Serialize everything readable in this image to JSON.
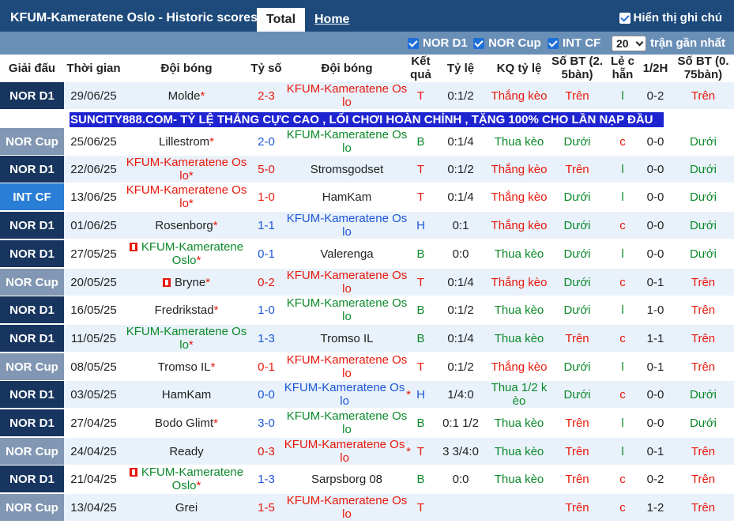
{
  "header": {
    "title": "KFUM-Kameratene Oslo - Historic scores",
    "tab_total": "Total",
    "tab_home": "Home",
    "show_label": "Hiển thị ghi chú"
  },
  "filters": {
    "nor_d1": "NOR D1",
    "nor_cup": "NOR Cup",
    "int_cf": "INT CF",
    "count": "20",
    "count_suffix": "trận gần nhất"
  },
  "columns": {
    "league": "Giải đấu",
    "time": "Thời gian",
    "home": "Đội bóng",
    "score": "Tỷ số",
    "away": "Đội bóng",
    "result": "Kết quả",
    "rate": "Tỷ lệ",
    "kq_rate": "KQ tỷ lệ",
    "bt25": "Số BT (2. 5bàn)",
    "odd_even": "Lẻ c hẵn",
    "half": "1/2H",
    "bt075": "Số BT (0. 75bàn)"
  },
  "ad_text": "SUNCITY888.COM- TỶ LỆ THẮNG CỰC CAO , LỐI CHƠI HOÀN CHỈNH , TẶNG 100% CHO LẦN NẠP ĐẦU",
  "rows": [
    {
      "league": "NOR D1",
      "date": "29/06/25",
      "home": "Molde",
      "home_star": "*",
      "score": "2-3",
      "away": "KFUM-Kameratene Os lo",
      "away_star": "",
      "result": "T",
      "rate": "0:1/2",
      "kq": "Thắng kèo",
      "bt": "Trên",
      "le": "l",
      "half": "0-2",
      "bt2": "Trên"
    },
    {
      "league": "NOR Cup",
      "date": "25/06/25",
      "home": "Lillestrom",
      "home_star": "*",
      "score": "2-0",
      "away": "KFUM-Kameratene Os lo",
      "away_star": "",
      "result": "B",
      "rate": "0:1/4",
      "kq": "Thua kèo",
      "bt": "Dưới",
      "le": "c",
      "half": "0-0",
      "bt2": "Dưới"
    },
    {
      "league": "NOR D1",
      "date": "22/06/25",
      "home": "KFUM-Kameratene Os lo",
      "home_star": "*",
      "score": "5-0",
      "away": "Stromsgodset",
      "away_star": "",
      "result": "T",
      "rate": "0:1/2",
      "kq": "Thắng kèo",
      "bt": "Trên",
      "le": "l",
      "half": "0-0",
      "bt2": "Dưới"
    },
    {
      "league": "INT CF",
      "date": "13/06/25",
      "home": "KFUM-Kameratene Os lo",
      "home_star": "*",
      "score": "1-0",
      "away": "HamKam",
      "away_star": "",
      "result": "T",
      "rate": "0:1/4",
      "kq": "Thắng kèo",
      "bt": "Dưới",
      "le": "l",
      "half": "0-0",
      "bt2": "Dưới"
    },
    {
      "league": "NOR D1",
      "date": "01/06/25",
      "home": "Rosenborg",
      "home_star": "*",
      "score": "1-1",
      "away": "KFUM-Kameratene Os lo",
      "away_star": "",
      "result": "H",
      "rate": "0:1",
      "kq": "Thắng kèo",
      "bt": "Dưới",
      "le": "c",
      "half": "0-0",
      "bt2": "Dưới"
    },
    {
      "league": "NOR D1",
      "date": "27/05/25",
      "home": "KFUM-Kameratene Oslo",
      "home_star": "*",
      "home_flag": true,
      "score": "0-1",
      "away": "Valerenga",
      "away_star": "",
      "result": "B",
      "rate": "0:0",
      "kq": "Thua kèo",
      "bt": "Dưới",
      "le": "l",
      "half": "0-0",
      "bt2": "Dưới"
    },
    {
      "league": "NOR Cup",
      "date": "20/05/25",
      "home": "Bryne",
      "home_star": "*",
      "home_flag": true,
      "score": "0-2",
      "away": "KFUM-Kameratene Os lo",
      "away_star": "",
      "result": "T",
      "rate": "0:1/4",
      "kq": "Thắng kèo",
      "bt": "Dưới",
      "le": "c",
      "half": "0-1",
      "bt2": "Trên"
    },
    {
      "league": "NOR D1",
      "date": "16/05/25",
      "home": "Fredrikstad",
      "home_star": "*",
      "score": "1-0",
      "away": "KFUM-Kameratene Os lo",
      "away_star": "",
      "result": "B",
      "rate": "0:1/2",
      "kq": "Thua kèo",
      "bt": "Dưới",
      "le": "l",
      "half": "1-0",
      "bt2": "Trên"
    },
    {
      "league": "NOR D1",
      "date": "11/05/25",
      "home": "KFUM-Kameratene Os lo",
      "home_star": "*",
      "score": "1-3",
      "away": "Tromso IL",
      "away_star": "",
      "result": "B",
      "rate": "0:1/4",
      "kq": "Thua kèo",
      "bt": "Trên",
      "le": "c",
      "half": "1-1",
      "bt2": "Trên"
    },
    {
      "league": "NOR Cup",
      "date": "08/05/25",
      "home": "Tromso IL",
      "home_star": "*",
      "score": "0-1",
      "away": "KFUM-Kameratene Os lo",
      "away_star": "",
      "result": "T",
      "rate": "0:1/2",
      "kq": "Thắng kèo",
      "bt": "Dưới",
      "le": "l",
      "half": "0-1",
      "bt2": "Trên"
    },
    {
      "league": "NOR D1",
      "date": "03/05/25",
      "home": "HamKam",
      "home_star": "",
      "score": "0-0",
      "away": "KFUM-Kameratene Os lo",
      "away_star": "*",
      "result": "H",
      "rate": "1/4:0",
      "kq": "Thua 1/2 k èo",
      "bt": "Dưới",
      "le": "c",
      "half": "0-0",
      "bt2": "Dưới"
    },
    {
      "league": "NOR D1",
      "date": "27/04/25",
      "home": "Bodo Glimt",
      "home_star": "*",
      "score": "3-0",
      "away": "KFUM-Kameratene Os lo",
      "away_star": "",
      "result": "B",
      "rate": "0:1 1/2",
      "kq": "Thua kèo",
      "bt": "Trên",
      "le": "l",
      "half": "0-0",
      "bt2": "Dưới"
    },
    {
      "league": "NOR Cup",
      "date": "24/04/25",
      "home": "Ready",
      "home_star": "",
      "score": "0-3",
      "away": "KFUM-Kameratene Os lo",
      "away_star": "*",
      "result": "T",
      "rate": "3 3/4:0",
      "kq": "Thua kèo",
      "bt": "Trên",
      "le": "l",
      "half": "0-1",
      "bt2": "Trên"
    },
    {
      "league": "NOR D1",
      "date": "21/04/25",
      "home": "KFUM-Kameratene Oslo",
      "home_star": "*",
      "home_flag": true,
      "score": "1-3",
      "away": "Sarpsborg 08",
      "away_star": "",
      "result": "B",
      "rate": "0:0",
      "kq": "Thua kèo",
      "bt": "Trên",
      "le": "c",
      "half": "0-2",
      "bt2": "Trên"
    },
    {
      "league": "NOR Cup",
      "date": "13/04/25",
      "home": "Grei",
      "home_star": "",
      "score": "1-5",
      "away": "KFUM-Kameratene Os lo",
      "away_star": "",
      "result": "T",
      "rate": "",
      "kq": "",
      "bt": "Trên",
      "le": "c",
      "half": "1-2",
      "bt2": "Trên"
    }
  ]
}
